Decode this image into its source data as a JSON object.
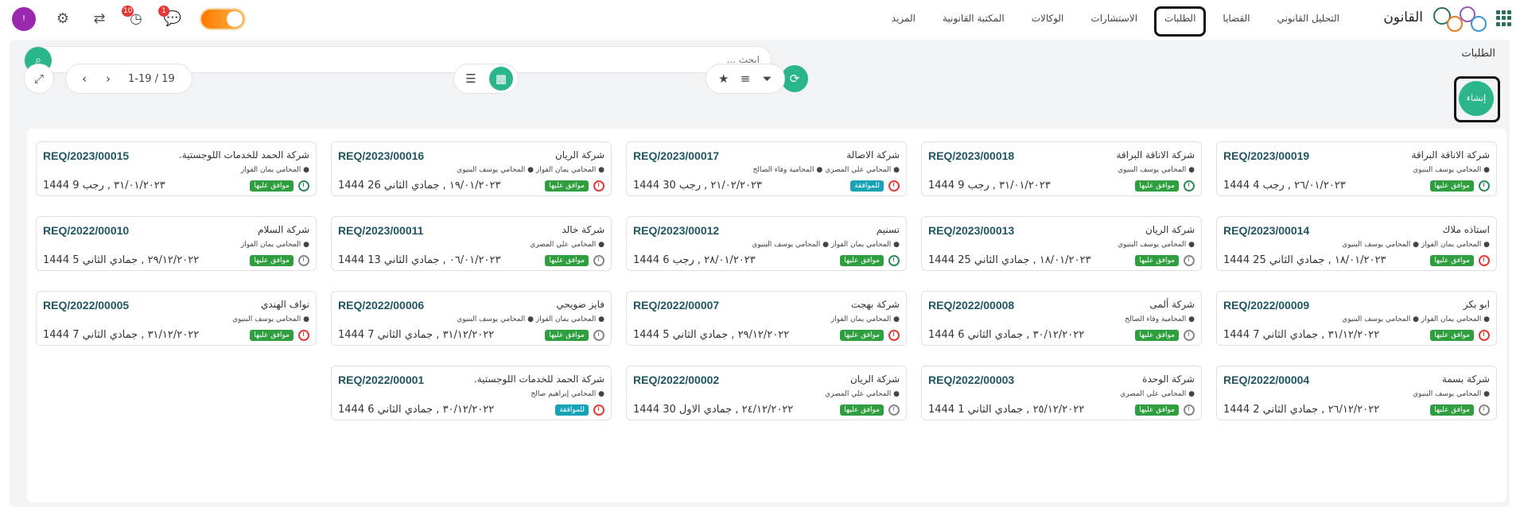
{
  "topbar": {
    "brand": "القانون",
    "menu": [
      "التحليل القانوني",
      "القضايا",
      "الطلبات",
      "الاستشارات",
      "الوكالات",
      "المكتبة القانونية",
      "المزيد"
    ],
    "active_menu": "الطلبات",
    "avatar_letter": "!",
    "activity_count": "10",
    "messages_count": "1"
  },
  "page": {
    "title": "الطلبات",
    "search_placeholder": "ابحث ...",
    "create_label": "إنشاء",
    "pager": "1-19 / 19"
  },
  "cards": [
    {
      "num": "REQ/2023/00019",
      "company": "شركة الاناقة البراقة",
      "lawyers": "● المحامي يوسف البنيوي",
      "date": "٢٦/٠١/٢٠٢٣ , رجب 4 1444",
      "status": "موافق عليها",
      "status_type": "approved",
      "clock": "green"
    },
    {
      "num": "REQ/2023/00018",
      "company": "شركة الاناقة البراقة",
      "lawyers": "● المحامي يوسف البنيوي",
      "date": "٣١/٠١/٢٠٢٣ , رجب 9 1444",
      "status": "موافق عليها",
      "status_type": "approved",
      "clock": "green"
    },
    {
      "num": "REQ/2023/00017",
      "company": "شركة الاصالة",
      "lawyers": "● المحامي علي المصري ● المحامية وفاء الصالح",
      "date": "٢١/٠٢/٢٠٢٣ , رجب 30 1444",
      "status": "للموافقة",
      "status_type": "pending",
      "clock": "red"
    },
    {
      "num": "REQ/2023/00016",
      "company": "شركة الريان",
      "lawyers": "● المحامي يمان الفواز ● المحامي يوسف البنيوي",
      "date": "١٩/٠١/٢٠٢٣ , جمادي الثاني 26 1444",
      "status": "موافق عليها",
      "status_type": "approved",
      "clock": "red"
    },
    {
      "num": "REQ/2023/00015",
      "company": "شركة الحمد للخدمات اللوجستية.",
      "lawyers": "● المحامي يمان الفواز",
      "date": "٣١/٠١/٢٠٢٣ , رجب 9 1444",
      "status": "موافق عليها",
      "status_type": "approved",
      "clock": "green"
    },
    {
      "num": "REQ/2023/00014",
      "company": "استاذه ملاك",
      "lawyers": "● المحامي يمان الفواز ● المحامي يوسف البنيوي",
      "date": "١٨/٠١/٢٠٢٣ , جمادي الثاني 25 1444",
      "status": "موافق عليها",
      "status_type": "approved",
      "clock": "red"
    },
    {
      "num": "REQ/2023/00013",
      "company": "شركة الريان",
      "lawyers": "● المحامي يوسف البنيوي",
      "date": "١٨/٠١/٢٠٢٣ , جمادي الثاني 25 1444",
      "status": "موافق عليها",
      "status_type": "approved",
      "clock": "gray"
    },
    {
      "num": "REQ/2023/00012",
      "company": "تسنيم",
      "lawyers": "● المحامي يمان الفواز ● المحامي يوسف البنيوي",
      "date": "٢٨/٠١/٢٠٢٣ , رجب 6 1444",
      "status": "موافق عليها",
      "status_type": "approved",
      "clock": "green"
    },
    {
      "num": "REQ/2023/00011",
      "company": "شركة خالد",
      "lawyers": "● المحامي علي المصري",
      "date": "٠٦/٠١/٢٠٢٣ , جمادي الثاني 13 1444",
      "status": "موافق عليها",
      "status_type": "approved",
      "clock": "gray"
    },
    {
      "num": "REQ/2022/00010",
      "company": "شركة السلام",
      "lawyers": "● المحامي يمان الفواز",
      "date": "٢٩/١٢/٢٠٢٢ , جمادي الثاني 5 1444",
      "status": "موافق عليها",
      "status_type": "approved",
      "clock": "gray"
    },
    {
      "num": "REQ/2022/00009",
      "company": "ابو بكر",
      "lawyers": "● المحامي يمان الفواز ● المحامي يوسف البنيوي",
      "date": "٣١/١٢/٢٠٢٢ , جمادي الثاني 7 1444",
      "status": "موافق عليها",
      "status_type": "approved",
      "clock": "red"
    },
    {
      "num": "REQ/2022/00008",
      "company": "شركة ألمى",
      "lawyers": "● المحامية وفاء الصالح",
      "date": "٣٠/١٢/٢٠٢٢ , جمادي الثاني 6 1444",
      "status": "موافق عليها",
      "status_type": "approved",
      "clock": "gray"
    },
    {
      "num": "REQ/2022/00007",
      "company": "شركة بهجت",
      "lawyers": "● المحامي يمان الفواز",
      "date": "٢٩/١٢/٢٠٢٢ , جمادي الثاني 5 1444",
      "status": "موافق عليها",
      "status_type": "approved",
      "clock": "red"
    },
    {
      "num": "REQ/2022/00006",
      "company": "فايز ضويحي",
      "lawyers": "● المحامي يمان الفواز ● المحامي يوسف البنيوي",
      "date": "٣١/١٢/٢٠٢٢ , جمادي الثاني 7 1444",
      "status": "موافق عليها",
      "status_type": "approved",
      "clock": "gray"
    },
    {
      "num": "REQ/2022/00005",
      "company": "نواف الهندي",
      "lawyers": "● المحامي يوسف البنيوي",
      "date": "٣١/١٢/٢٠٢٢ , جمادي الثاني 7 1444",
      "status": "موافق عليها",
      "status_type": "approved",
      "clock": "red"
    },
    {
      "num": "REQ/2022/00004",
      "company": "شركة بسمة",
      "lawyers": "● المحامي يوسف البنيوي",
      "date": "٢٦/١٢/٢٠٢٢ , جمادي الثاني 2 1444",
      "status": "موافق عليها",
      "status_type": "approved",
      "clock": "gray"
    },
    {
      "num": "REQ/2022/00003",
      "company": "شركة الوحدة",
      "lawyers": "● المحامي علي المصري",
      "date": "٢٥/١٢/٢٠٢٢ , جمادي الثاني 1 1444",
      "status": "موافق عليها",
      "status_type": "approved",
      "clock": "gray"
    },
    {
      "num": "REQ/2022/00002",
      "company": "شركة الريان",
      "lawyers": "● المحامي علي المصري",
      "date": "٢٤/١٢/٢٠٢٢ , جمادي الاول 30 1444",
      "status": "موافق عليها",
      "status_type": "approved",
      "clock": "gray"
    },
    {
      "num": "REQ/2022/00001",
      "company": "شركة الحمد للخدمات اللوجستية.",
      "lawyers": "● المحامي إبراهيم صالح",
      "date": "٣٠/١٢/٢٠٢٢ , جمادي الثاني 6 1444",
      "status": "للموافقة",
      "status_type": "pending",
      "clock": "red"
    }
  ]
}
